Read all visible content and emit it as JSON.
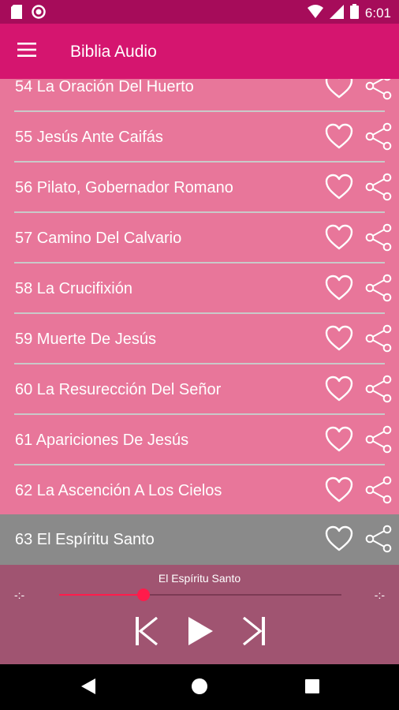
{
  "status_bar": {
    "time": "6:01",
    "icons": [
      "sd-card-icon",
      "circle-status-icon",
      "wifi-icon",
      "cell-signal-icon",
      "battery-icon"
    ]
  },
  "app_bar": {
    "title": "Biblia Audio",
    "menu_icon": "hamburger-menu-icon"
  },
  "list": {
    "items": [
      {
        "label": "54 La Oración Del Huerto"
      },
      {
        "label": "55 Jesús Ante Caifás"
      },
      {
        "label": "56 Pilato, Gobernador Romano"
      },
      {
        "label": "57 Camino Del Calvario"
      },
      {
        "label": "58 La Crucifixión"
      },
      {
        "label": "59 Muerte De Jesús"
      },
      {
        "label": "60 La Resurección Del Señor"
      },
      {
        "label": "61 Apariciones De Jesús"
      },
      {
        "label": "62 La Ascención A Los Cielos"
      },
      {
        "label": "63 El Espíritu Santo",
        "active": true
      }
    ],
    "item_icons": [
      "heart-outline-icon",
      "share-icon"
    ]
  },
  "player": {
    "now_playing": "El Espíritu Santo",
    "elapsed": "-:-",
    "duration": "-:-",
    "progress": 0.3,
    "controls": [
      "skip-previous-icon",
      "play-icon",
      "skip-next-icon"
    ]
  },
  "nav_bar": {
    "buttons": [
      "back-triangle-icon",
      "home-circle-icon",
      "recents-square-icon"
    ]
  },
  "colors": {
    "status_bar": "#a60c5a",
    "app_bar": "#d5156f",
    "list_bg": "#e8769a",
    "active_row": "#8a8a8a",
    "player_bg": "#a05471",
    "seek_accent": "#ff1b4b"
  }
}
